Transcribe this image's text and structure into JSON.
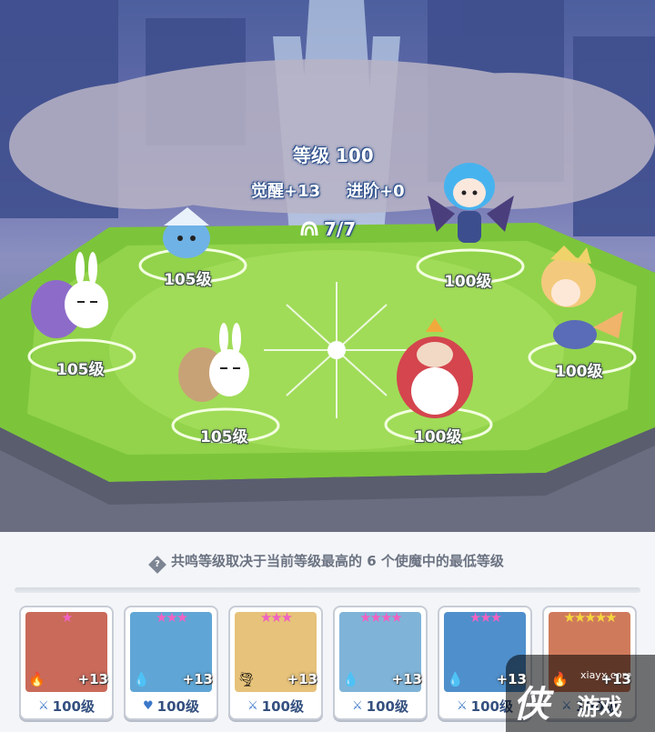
{
  "stats": {
    "level": "等级 100",
    "awaken": "觉醒+13",
    "advance": "进阶+0",
    "resonance": "7/7"
  },
  "scene_characters": [
    {
      "name": "crab",
      "level": "105级"
    },
    {
      "name": "purple-snail-bunny",
      "level": "105级"
    },
    {
      "name": "brown-snail-bunny",
      "level": "105级"
    },
    {
      "name": "blue-bat-girl",
      "level": "100级"
    },
    {
      "name": "mermaid",
      "level": "100级"
    },
    {
      "name": "red-bear",
      "level": "100级"
    }
  ],
  "info": "共鸣等级取决于当前等级最高的 6 个使魔中的最低等级",
  "cards": [
    {
      "stars": "★",
      "star_color": "#f062c2",
      "elem_icon": "fire-icon",
      "elem_glyph": "🔥",
      "plus": "+13",
      "class_glyph": "⚔",
      "level": "100级",
      "portrait_color": "#c96a5a"
    },
    {
      "stars": "★★★",
      "star_color": "#f062c2",
      "elem_icon": "water-icon",
      "elem_glyph": "💧",
      "plus": "+13",
      "class_glyph": "♥",
      "level": "100级",
      "portrait_color": "#5fa6d6"
    },
    {
      "stars": "★★★",
      "star_color": "#f062c2",
      "elem_icon": "wind-icon",
      "elem_glyph": "🌪",
      "plus": "+13",
      "class_glyph": "⚔",
      "level": "100级",
      "portrait_color": "#e6c27a"
    },
    {
      "stars": "★★★★",
      "star_color": "#f062c2",
      "elem_icon": "water-icon",
      "elem_glyph": "💧",
      "plus": "+13",
      "class_glyph": "⚔",
      "level": "100级",
      "portrait_color": "#7fb4d8"
    },
    {
      "stars": "★★★",
      "star_color": "#f062c2",
      "elem_icon": "water-icon",
      "elem_glyph": "💧",
      "plus": "+13",
      "class_glyph": "⚔",
      "level": "100级",
      "portrait_color": "#4e8fcc"
    },
    {
      "stars": "★★★★★",
      "star_color": "#f5d63d",
      "elem_icon": "fire-icon",
      "elem_glyph": "🔥",
      "plus": "+13",
      "class_glyph": "⚔",
      "level": "100级",
      "portrait_color": "#d07a5c"
    }
  ],
  "watermark": {
    "site": "xiayx.com",
    "logo": "侠",
    "brand": "游戏"
  }
}
